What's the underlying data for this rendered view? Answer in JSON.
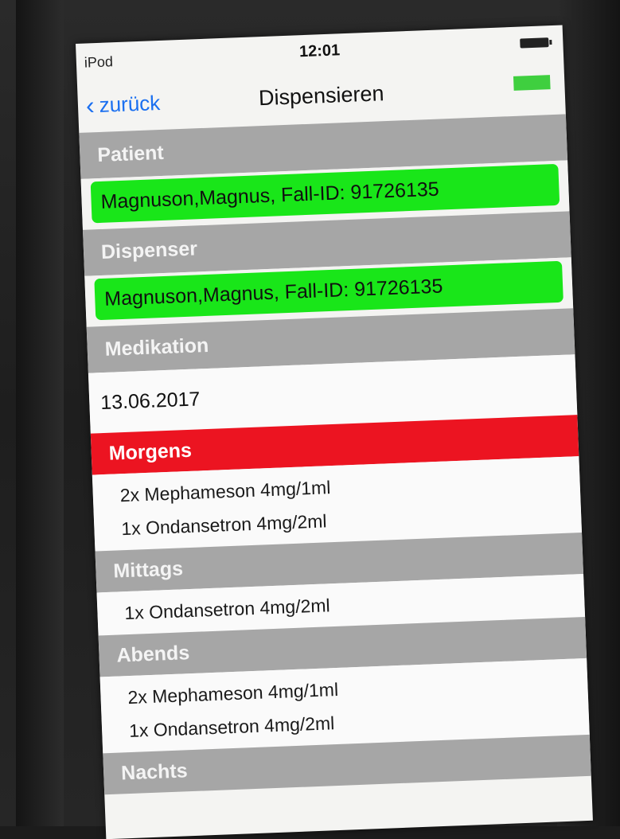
{
  "status_bar": {
    "carrier": "iPod",
    "time": "12:01"
  },
  "nav": {
    "back_label": "zurück",
    "title": "Dispensieren"
  },
  "patient": {
    "header": "Patient",
    "value": "Magnuson,Magnus, Fall-ID: 91726135"
  },
  "dispenser": {
    "header": "Dispenser",
    "value": "Magnuson,Magnus, Fall-ID: 91726135"
  },
  "medication": {
    "header": "Medikation",
    "date": "13.06.2017",
    "slots": [
      {
        "label": "Morgens",
        "highlighted": true,
        "items": [
          "2x Mephameson 4mg/1ml",
          "1x Ondansetron 4mg/2ml"
        ]
      },
      {
        "label": "Mittags",
        "highlighted": false,
        "items": [
          "1x Ondansetron 4mg/2ml"
        ]
      },
      {
        "label": "Abends",
        "highlighted": false,
        "items": [
          "2x Mephameson 4mg/1ml",
          "1x Ondansetron 4mg/2ml"
        ]
      },
      {
        "label": "Nachts",
        "highlighted": false,
        "items": []
      }
    ]
  },
  "colors": {
    "accent": "#1a6ff0",
    "section_header": "#a6a6a6",
    "highlight_header": "#ec1421",
    "valid_field": "#19e619"
  },
  "icons": {
    "back": "chevron-left-icon",
    "battery": "battery-icon"
  }
}
